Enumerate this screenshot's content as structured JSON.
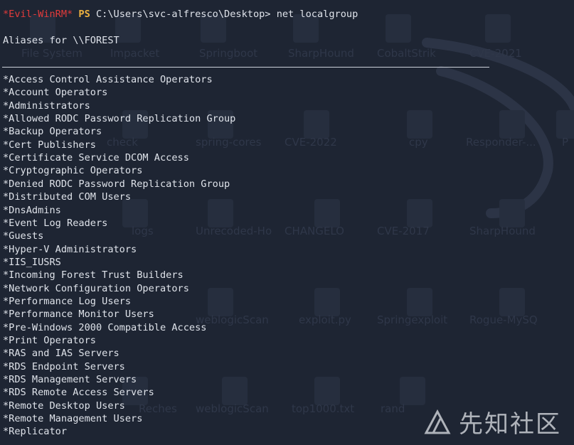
{
  "terminal": {
    "prompt_tag": "*Evil-WinRM*",
    "prompt_ps": "PS",
    "prompt_path": "C:\\Users\\svc-alfresco\\Desktop>",
    "command": "net localgroup",
    "aliases_header": "Aliases for \\\\FOREST",
    "groups": [
      "*Access Control Assistance Operators",
      "*Account Operators",
      "*Administrators",
      "*Allowed RODC Password Replication Group",
      "*Backup Operators",
      "*Cert Publishers",
      "*Certificate Service DCOM Access",
      "*Cryptographic Operators",
      "*Denied RODC Password Replication Group",
      "*Distributed COM Users",
      "*DnsAdmins",
      "*Event Log Readers",
      "*Guests",
      "*Hyper-V Administrators",
      "*IIS_IUSRS",
      "*Incoming Forest Trust Builders",
      "*Network Configuration Operators",
      "*Performance Log Users",
      "*Performance Monitor Users",
      "*Pre-Windows 2000 Compatible Access",
      "*Print Operators",
      "*RAS and IAS Servers",
      "*RDS Endpoint Servers",
      "*RDS Management Servers",
      "*RDS Remote Access Servers",
      "*Remote Desktop Users",
      "*Remote Management Users",
      "*Replicator"
    ]
  },
  "background": {
    "desktop_icons": [
      "File System",
      "Impacket",
      "Springboot",
      "SharpHound",
      "CobaltStrik",
      "CVE-2021",
      "check",
      "spring-cores",
      "CVE-2022",
      "cpy",
      "Responder-...",
      "P",
      "logs",
      "Unrecoded-Ho",
      "CHANGELO",
      "CVE-2017",
      "SharpHound",
      "weblogicScan",
      "exploit.py",
      "Springexploit",
      "Rogue-MySQ",
      "Reches",
      "weblogicScan",
      "top1000.txt",
      "rand"
    ]
  },
  "watermark": {
    "text": "先知社区"
  },
  "colors": {
    "background": "#1e2533",
    "text": "#dfe3ea",
    "prompt_tag": "#e23b3b",
    "prompt_ps": "#f0b340"
  }
}
